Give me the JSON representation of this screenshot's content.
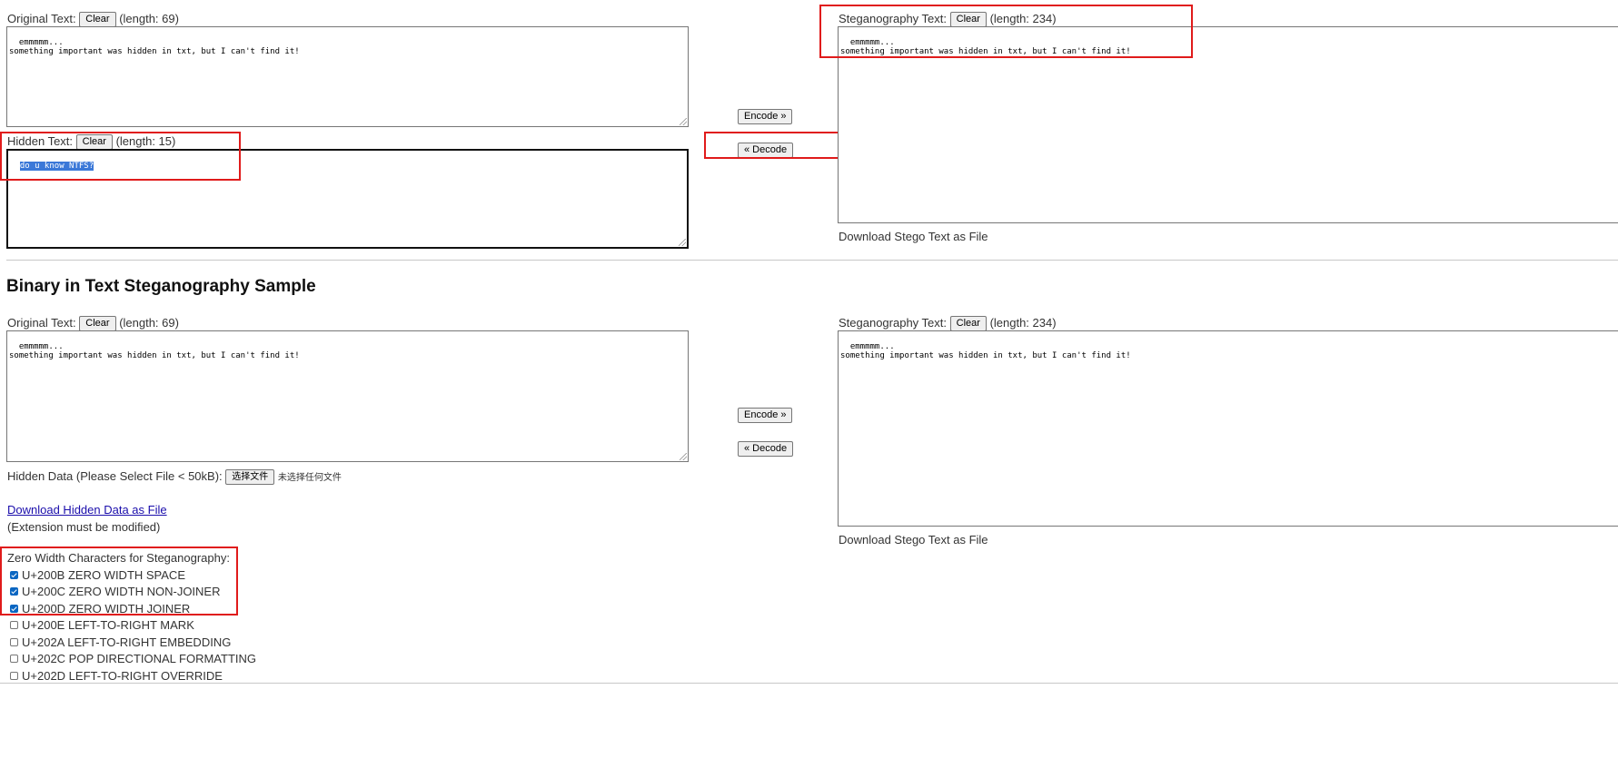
{
  "section1": {
    "original_label": "Original Text:",
    "original_length": "(length: 69)",
    "original_text": "emmmmm...\nsomething important was hidden in txt, but I can't find it!",
    "hidden_label": "Hidden Text:",
    "hidden_length": "(length: 15)",
    "hidden_text": "do u know NTFS?",
    "stego_label": "Steganography Text:",
    "stego_length": "(length: 234)",
    "stego_text": "emmmmm...\nsomething important was hidden in txt, but I can't find it!",
    "encode_label": "Encode »",
    "decode_label": "« Decode",
    "clear_label": "Clear",
    "download_stego": "Download Stego Text as File"
  },
  "section2": {
    "heading": "Binary in Text Steganography Sample",
    "original_label": "Original Text:",
    "original_length": "(length: 69)",
    "original_text": "emmmmm...\nsomething important was hidden in txt, but I can't find it!",
    "stego_label": "Steganography Text:",
    "stego_length": "(length: 234)",
    "stego_text": "emmmmm...\nsomething important was hidden in txt, but I can't find it!",
    "encode_label": "Encode »",
    "decode_label": "« Decode",
    "clear_label": "Clear",
    "hidden_data_label": "Hidden Data (Please Select File < 50kB):",
    "file_button": "选择文件",
    "file_status": "未选择任何文件",
    "download_hidden": "Download Hidden Data as File",
    "extension_note": "(Extension must be modified)",
    "download_stego": "Download Stego Text as File"
  },
  "zero_width": {
    "title": "Zero Width Characters for Steganography:",
    "options": [
      {
        "label": "U+200B ZERO WIDTH SPACE",
        "checked": true
      },
      {
        "label": "U+200C ZERO WIDTH NON-JOINER",
        "checked": true
      },
      {
        "label": "U+200D ZERO WIDTH JOINER",
        "checked": true
      },
      {
        "label": "U+200E LEFT-TO-RIGHT MARK",
        "checked": false
      },
      {
        "label": "U+202A LEFT-TO-RIGHT EMBEDDING",
        "checked": false
      },
      {
        "label": "U+202C POP DIRECTIONAL FORMATTING",
        "checked": false
      },
      {
        "label": "U+202D LEFT-TO-RIGHT OVERRIDE",
        "checked": false
      }
    ]
  },
  "colors": {
    "highlight_box": "#e01b1b",
    "selection": "#3b78d8",
    "link": "#1a0dab"
  }
}
